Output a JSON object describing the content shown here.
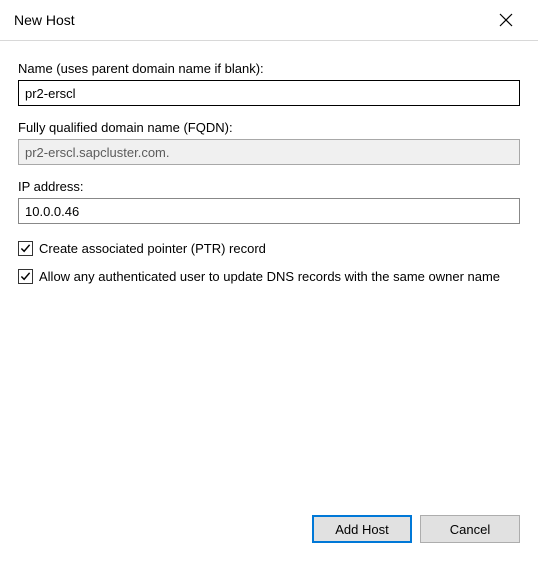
{
  "title": "New Host",
  "fields": {
    "name": {
      "label": "Name (uses parent domain name if blank):",
      "value": "pr2-erscl"
    },
    "fqdn": {
      "label": "Fully qualified domain name (FQDN):",
      "value": "pr2-erscl.sapcluster.com."
    },
    "ip": {
      "label": "IP address:",
      "value": "10.0.0.46"
    }
  },
  "checkboxes": {
    "ptr": {
      "label": "Create associated pointer (PTR) record",
      "checked": true
    },
    "allow_update": {
      "label": "Allow any authenticated user to update DNS records with the same owner name",
      "checked": true
    }
  },
  "buttons": {
    "add_host": "Add Host",
    "cancel": "Cancel"
  }
}
